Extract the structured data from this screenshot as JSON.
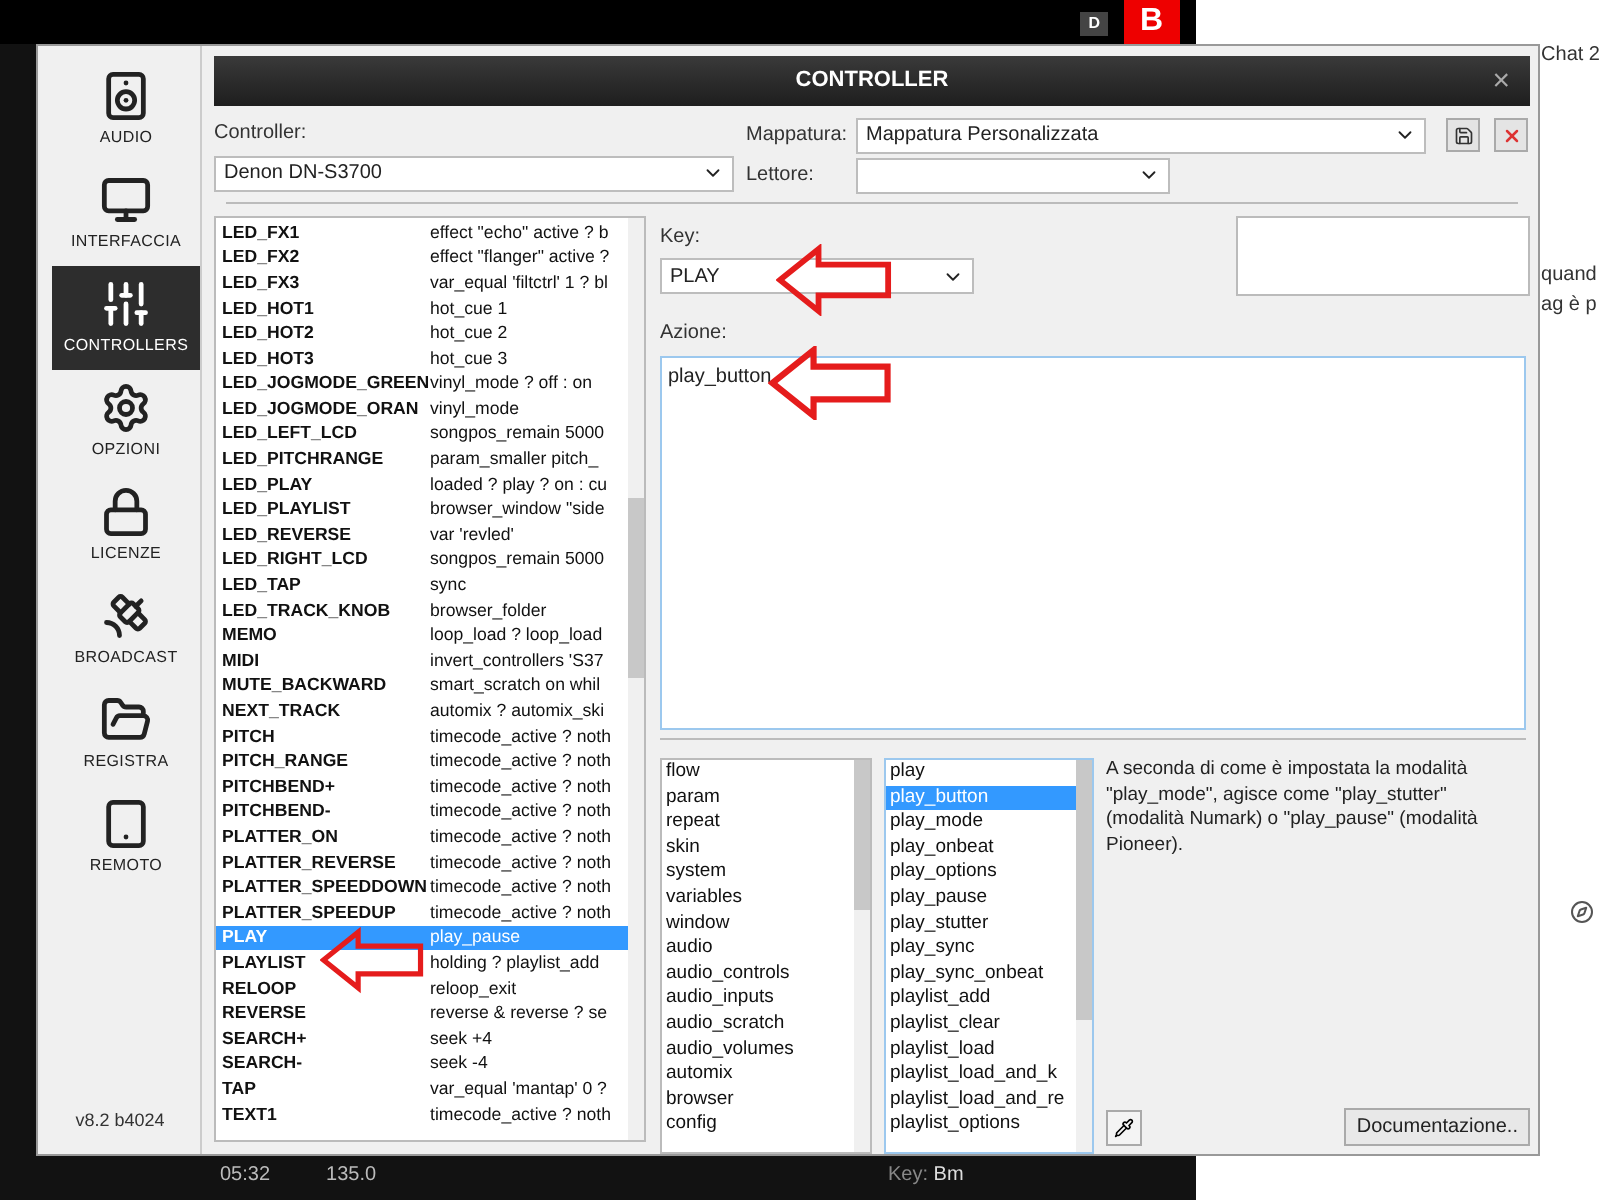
{
  "background": {
    "badge_letters": [
      "D",
      "B"
    ],
    "chat_title": "Chat 2",
    "right_texts": [
      "quand",
      "ag è p"
    ],
    "tracks": [
      {
        "time": "05:32",
        "bpm": "135.0"
      }
    ],
    "info": [
      {
        "label": "Key:",
        "value": "Bm"
      }
    ]
  },
  "sidebar": {
    "items": [
      {
        "label": "AUDIO",
        "selected": false
      },
      {
        "label": "INTERFACCIA",
        "selected": false
      },
      {
        "label": "CONTROLLERS",
        "selected": true
      },
      {
        "label": "OPZIONI",
        "selected": false
      },
      {
        "label": "LICENZE",
        "selected": false
      },
      {
        "label": "BROADCAST",
        "selected": false
      },
      {
        "label": "REGISTRA",
        "selected": false
      },
      {
        "label": "REMOTO",
        "selected": false
      }
    ],
    "version": "v8.2 b4024"
  },
  "window": {
    "title": "CONTROLLER",
    "close": "×"
  },
  "controller": {
    "label": "Controller:",
    "value": "Denon DN-S3700"
  },
  "mapping": {
    "label": "Mappatura:",
    "value": "Mappatura Personalizzata"
  },
  "player": {
    "label": "Lettore:"
  },
  "mappings": [
    {
      "key": "LED_FX1",
      "action": "effect \"echo\" active ? b",
      "selected": false
    },
    {
      "key": "LED_FX2",
      "action": "effect \"flanger\" active ?",
      "selected": false
    },
    {
      "key": "LED_FX3",
      "action": "var_equal 'filtctrl' 1 ? bl",
      "selected": false
    },
    {
      "key": "LED_HOT1",
      "action": "hot_cue 1",
      "selected": false
    },
    {
      "key": "LED_HOT2",
      "action": "hot_cue 2",
      "selected": false
    },
    {
      "key": "LED_HOT3",
      "action": "hot_cue 3",
      "selected": false
    },
    {
      "key": "LED_JOGMODE_GREEN",
      "action": "vinyl_mode ? off : on",
      "selected": false
    },
    {
      "key": "LED_JOGMODE_ORAN",
      "action": "vinyl_mode",
      "selected": false
    },
    {
      "key": "LED_LEFT_LCD",
      "action": "songpos_remain 5000",
      "selected": false
    },
    {
      "key": "LED_PITCHRANGE",
      "action": "param_smaller pitch_",
      "selected": false
    },
    {
      "key": "LED_PLAY",
      "action": "loaded ? play ? on : cu",
      "selected": false
    },
    {
      "key": "LED_PLAYLIST",
      "action": "browser_window \"side",
      "selected": false
    },
    {
      "key": "LED_REVERSE",
      "action": "var 'revled'",
      "selected": false
    },
    {
      "key": "LED_RIGHT_LCD",
      "action": "songpos_remain 5000",
      "selected": false
    },
    {
      "key": "LED_TAP",
      "action": "sync",
      "selected": false
    },
    {
      "key": "LED_TRACK_KNOB",
      "action": "browser_folder",
      "selected": false
    },
    {
      "key": "MEMO",
      "action": "loop_load ? loop_load",
      "selected": false
    },
    {
      "key": "MIDI",
      "action": "invert_controllers 'S37",
      "selected": false
    },
    {
      "key": "MUTE_BACKWARD",
      "action": "smart_scratch on whil",
      "selected": false
    },
    {
      "key": "NEXT_TRACK",
      "action": "automix ? automix_ski",
      "selected": false
    },
    {
      "key": "PITCH",
      "action": "timecode_active ? noth",
      "selected": false
    },
    {
      "key": "PITCH_RANGE",
      "action": "timecode_active ? noth",
      "selected": false
    },
    {
      "key": "PITCHBEND+",
      "action": "timecode_active ? noth",
      "selected": false
    },
    {
      "key": "PITCHBEND-",
      "action": "timecode_active ? noth",
      "selected": false
    },
    {
      "key": "PLATTER_ON",
      "action": "timecode_active ? noth",
      "selected": false
    },
    {
      "key": "PLATTER_REVERSE",
      "action": "timecode_active ? noth",
      "selected": false
    },
    {
      "key": "PLATTER_SPEEDDOWN",
      "action": "timecode_active ? noth",
      "selected": false
    },
    {
      "key": "PLATTER_SPEEDUP",
      "action": "timecode_active ? noth",
      "selected": false
    },
    {
      "key": "PLAY",
      "action": "play_pause",
      "selected": true
    },
    {
      "key": "PLAYLIST",
      "action": "holding ? playlist_add",
      "selected": false
    },
    {
      "key": "RELOOP",
      "action": "reloop_exit",
      "selected": false
    },
    {
      "key": "REVERSE",
      "action": "reverse & reverse ? se",
      "selected": false
    },
    {
      "key": "SEARCH+",
      "action": "seek +4",
      "selected": false
    },
    {
      "key": "SEARCH-",
      "action": "seek -4",
      "selected": false
    },
    {
      "key": "TAP",
      "action": "var_equal 'mantap' 0 ?",
      "selected": false
    },
    {
      "key": "TEXT1",
      "action": "timecode_active ? noth",
      "selected": false
    }
  ],
  "key": {
    "label": "Key:",
    "value": "PLAY"
  },
  "action": {
    "label": "Azione:",
    "value": "play_button"
  },
  "categories": [
    {
      "label": "flow",
      "selected": false
    },
    {
      "label": "param",
      "selected": false
    },
    {
      "label": "repeat",
      "selected": false
    },
    {
      "label": "skin",
      "selected": false
    },
    {
      "label": "system",
      "selected": false
    },
    {
      "label": "variables",
      "selected": false
    },
    {
      "label": "window",
      "selected": false
    },
    {
      "label": "audio",
      "selected": false
    },
    {
      "label": "audio_controls",
      "selected": false
    },
    {
      "label": "audio_inputs",
      "selected": false
    },
    {
      "label": "audio_scratch",
      "selected": false
    },
    {
      "label": "audio_volumes",
      "selected": false
    },
    {
      "label": "automix",
      "selected": false
    },
    {
      "label": "browser",
      "selected": false
    },
    {
      "label": "config",
      "selected": false
    }
  ],
  "verbs": [
    {
      "label": "play",
      "selected": false
    },
    {
      "label": "play_button",
      "selected": true
    },
    {
      "label": "play_mode",
      "selected": false
    },
    {
      "label": "play_onbeat",
      "selected": false
    },
    {
      "label": "play_options",
      "selected": false
    },
    {
      "label": "play_pause",
      "selected": false
    },
    {
      "label": "play_stutter",
      "selected": false
    },
    {
      "label": "play_sync",
      "selected": false
    },
    {
      "label": "play_sync_onbeat",
      "selected": false
    },
    {
      "label": "playlist_add",
      "selected": false
    },
    {
      "label": "playlist_clear",
      "selected": false
    },
    {
      "label": "playlist_load",
      "selected": false
    },
    {
      "label": "playlist_load_and_k",
      "selected": false
    },
    {
      "label": "playlist_load_and_re",
      "selected": false
    },
    {
      "label": "playlist_options",
      "selected": false
    }
  ],
  "description": "A seconda di come è impostata la modalità \"play_mode\", agisce come \"play_stutter\" (modalità Numark) o \"play_pause\" (modalità Pioneer).",
  "doc_button": "Documentazione.."
}
